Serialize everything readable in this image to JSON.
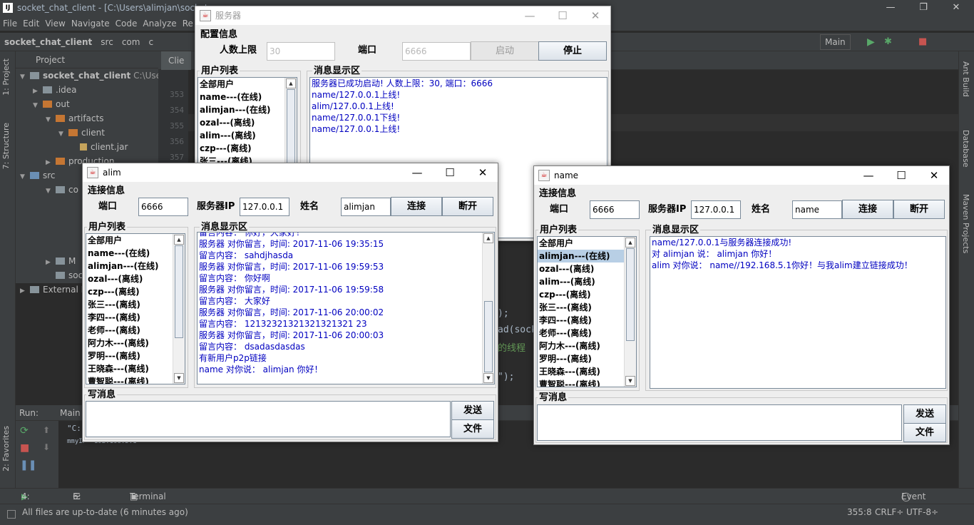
{
  "ide": {
    "title": "socket_chat_client - [C:\\Users\\alimjan\\socket_c",
    "menu": [
      "File",
      "Edit",
      "View",
      "Navigate",
      "Code",
      "Analyze",
      "Re"
    ],
    "breadcrumb": [
      "socket_chat_client",
      "src",
      "com",
      "c"
    ],
    "run_config": "Main",
    "project_label": "Project",
    "editor_tab": "Clie",
    "left_tabs": [
      "1: Project",
      "7: Structure",
      "2: Favorites"
    ],
    "right_tabs": [
      "Ant Build",
      "Database",
      "Maven Projects"
    ],
    "tree": [
      {
        "label": "socket_chat_client",
        "extra": "C:\\Users\\a",
        "bold": true
      },
      {
        "label": ".idea"
      },
      {
        "label": "out"
      },
      {
        "label": "artifacts"
      },
      {
        "label": "client"
      },
      {
        "label": "client.jar"
      },
      {
        "label": "production"
      },
      {
        "label": "src"
      },
      {
        "label": "co"
      },
      {
        "label": "M"
      },
      {
        "label": "socke"
      },
      {
        "label": "External L"
      }
    ],
    "line_numbers": [
      "353",
      "354",
      "355",
      "356",
      "357"
    ],
    "code_fragments": [
      ");",
      "ad(sock",
      "的线程",
      "\");"
    ],
    "run_label": "Run:",
    "run_tab": "Main",
    "console_prefix": "\"C:",
    "console_line": "mmyIP==192.168.5.1",
    "bottom_tabs": {
      "run": "4: Run",
      "todo": "6: TODO",
      "terminal": "Terminal",
      "event_log": "Event Log"
    },
    "status_text": "All files are up-to-date (6 minutes ago)",
    "status_right": {
      "position": "355:8",
      "line_sep": "CRLF÷",
      "encoding": "UTF-8÷"
    }
  },
  "server": {
    "title": "服务器",
    "config_label": "配置信息",
    "max_users_label": "人数上限",
    "max_users": "30",
    "port_label": "端口",
    "port": "6666",
    "start_label": "启动",
    "stop_label": "停止",
    "user_list_label": "用户列表",
    "users": [
      "全部用户",
      "name---(在线)",
      "alimjan---(在线)",
      "ozal---(离线)",
      "alim---(离线)",
      "czp---(离线)",
      "张三---(离线)"
    ],
    "msg_label": "消息显示区",
    "messages": [
      "服务器已成功启动!  人数上限：30, 端口：6666",
      "name/127.0.0.1上线!",
      "alim/127.0.0.1上线!",
      "name/127.0.0.1下线!",
      "name/127.0.0.1上线!"
    ]
  },
  "alim": {
    "title": "alim",
    "conn_label": "连接信息",
    "port_label": "端口",
    "port": "6666",
    "ip_label": "服务器IP",
    "ip": "127.0.0.1",
    "name_label": "姓名",
    "name": "alimjan",
    "connect_label": "连接",
    "disconnect_label": "断开",
    "user_list_label": "用户列表",
    "users": [
      "全部用户",
      "name---(在线)",
      "alimjan---(在线)",
      "ozal---(离线)",
      "czp---(离线)",
      "张三---(离线)",
      "李四---(离线)",
      "老师---(离线)",
      "阿力木---(离线)",
      "罗明---(离线)",
      "王晓森---(离线)",
      "曹智聪---(离线)"
    ],
    "msg_label": "消息显示区",
    "messages": [
      "  留言内容：  你好，大家好！",
      "服务器  对你留言，时间:   2017-11-06 19:35:15",
      "  留言内容：  sahdjhasda",
      "服务器  对你留言，时间:   2017-11-06 19:59:53",
      "  留言内容：  你好啊",
      "服务器  对你留言，时间:   2017-11-06 19:59:58",
      "  留言内容：  大家好",
      "服务器  对你留言，时间:   2017-11-06 20:00:02",
      "  留言内容：  12132321321321321321 23",
      "服务器  对你留言，时间:   2017-11-06 20:00:03",
      "  留言内容：  dsadasdasdas",
      "有新用户p2p链接",
      "name  对你说：  alimjan   你好！"
    ],
    "write_label": "写消息",
    "send_label": "发送",
    "file_label": "文件"
  },
  "name_win": {
    "title": "name",
    "conn_label": "连接信息",
    "port_label": "端口",
    "port": "6666",
    "ip_label": "服务器IP",
    "ip": "127.0.0.1",
    "name_label": "姓名",
    "name": "name",
    "connect_label": "连接",
    "disconnect_label": "断开",
    "user_list_label": "用户列表",
    "users": [
      "全部用户",
      "alimjan---(在线)",
      "ozal---(离线)",
      "alim---(离线)",
      "czp---(离线)",
      "张三---(离线)",
      "李四---(离线)",
      "老师---(离线)",
      "阿力木---(离线)",
      "罗明---(离线)",
      "王晓森---(离线)",
      "曹智聪---(离线)"
    ],
    "msg_label": "消息显示区",
    "messages": [
      "name/127.0.0.1与服务器连接成功!",
      "对  alimjan  说：  alimjan   你好！",
      "alim  对你说：   name//192.168.5.1你好！与我alim建立链接成功！"
    ],
    "write_label": "写消息",
    "send_label": "发送",
    "file_label": "文件"
  },
  "colors": {
    "ide_bg": "#2b2b2b",
    "ide_panel": "#3c3f41",
    "swing_bg": "#eeeeee",
    "message_text": "#0000c0",
    "selection": "#b8cfe5"
  }
}
